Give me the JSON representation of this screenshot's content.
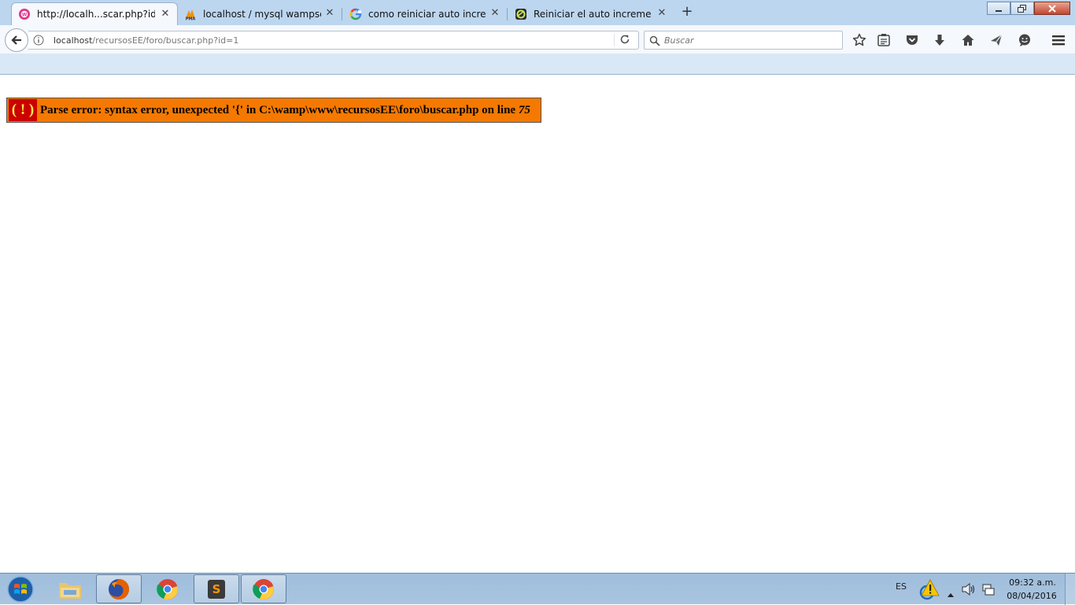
{
  "browser": {
    "tabs": [
      {
        "title": "http://localh...scar.php?id=1",
        "icon": "wampserver-icon",
        "active": true
      },
      {
        "title": "localhost / mysql wampser...",
        "icon": "phpmyadmin-icon",
        "active": false
      },
      {
        "title": "como reiniciar auto increm...",
        "icon": "google-icon",
        "active": false
      },
      {
        "title": "Reiniciar el auto increment...",
        "icon": "site-icon",
        "active": false
      }
    ],
    "new_tab_label": "+",
    "url_host": "localhost",
    "url_path": "/recursosEE/foro/buscar.php?id=1",
    "search_placeholder": "Buscar",
    "toolbar_icons": [
      "bookmark-star-icon",
      "reading-list-icon",
      "pocket-icon",
      "download-icon",
      "home-icon",
      "share-icon",
      "chat-icon",
      "menu-icon"
    ]
  },
  "page": {
    "error_badge": "( ! )",
    "error_message": "Parse error: syntax error, unexpected '{' in C:\\wamp\\www\\recursosEE\\foro\\buscar.php on line ",
    "error_line": "75",
    "colors": {
      "error_bg": "#f57900",
      "badge_bg": "#cc0000",
      "badge_fg": "#fce94f"
    }
  },
  "taskbar": {
    "apps": [
      "windows-start-icon",
      "file-explorer-icon",
      "firefox-icon",
      "chrome-icon",
      "sublime-text-icon",
      "chrome-icon"
    ],
    "language": "ES",
    "time": "09:32 a.m.",
    "date": "08/04/2016"
  }
}
